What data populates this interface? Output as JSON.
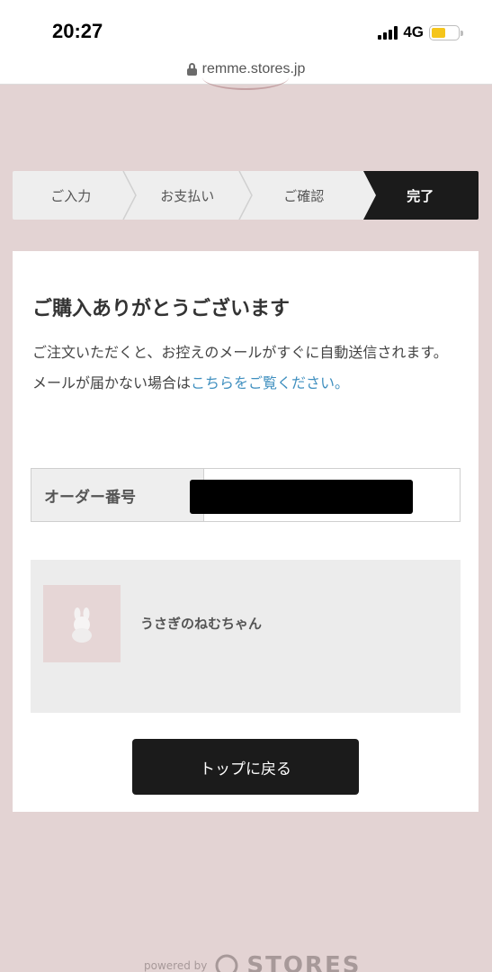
{
  "status_bar": {
    "time": "20:27",
    "network": "4G",
    "battery_level": 0.55
  },
  "browser": {
    "url": "remme.stores.jp"
  },
  "steps": [
    {
      "label": "ご入力"
    },
    {
      "label": "お支払い"
    },
    {
      "label": "ご確認"
    },
    {
      "label": "完了",
      "active": true
    }
  ],
  "confirmation": {
    "heading": "ご購入ありがとうございます",
    "message_line1": "ご注文いただくと、お控えのメールがすぐに自動送信されます。",
    "message_line2_prefix": "メールが届かない場合は",
    "message_line2_link": "こちらをご覧ください。",
    "order_label": "オーダー番号"
  },
  "item": {
    "name": "うさぎのねむちゃん"
  },
  "actions": {
    "back_to_top": "トップに戻る"
  },
  "footer": {
    "powered_by": "powered by",
    "brand": "STORES"
  },
  "colors": {
    "background": "#e3d3d3",
    "primary_dark": "#1b1b1b",
    "link": "#3f8fbf",
    "battery": "#f5c51b"
  }
}
